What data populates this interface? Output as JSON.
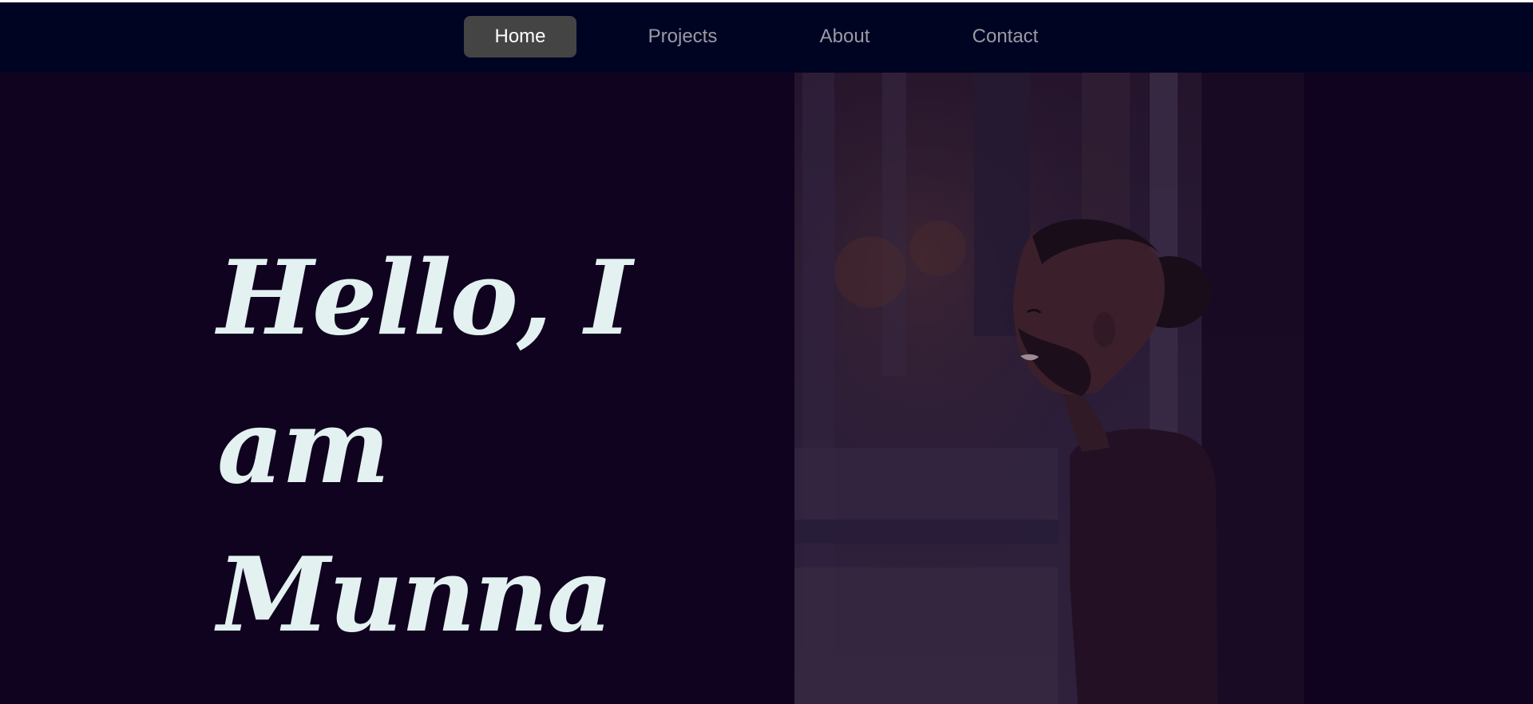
{
  "nav": {
    "items": [
      {
        "label": "Home",
        "active": true
      },
      {
        "label": "Projects",
        "active": false
      },
      {
        "label": "About",
        "active": false
      },
      {
        "label": "Contact",
        "active": false
      }
    ]
  },
  "hero": {
    "line1": "Hello, I am",
    "line2": "Munna",
    "photo_subject": "portrait-of-smiling-bearded-man"
  },
  "colors": {
    "navbar_bg": "#000423",
    "page_bg": "#10031f",
    "active_tab_bg": "#444444",
    "title_color": "#e3f1f0",
    "nav_text": "#9b9aa5"
  }
}
